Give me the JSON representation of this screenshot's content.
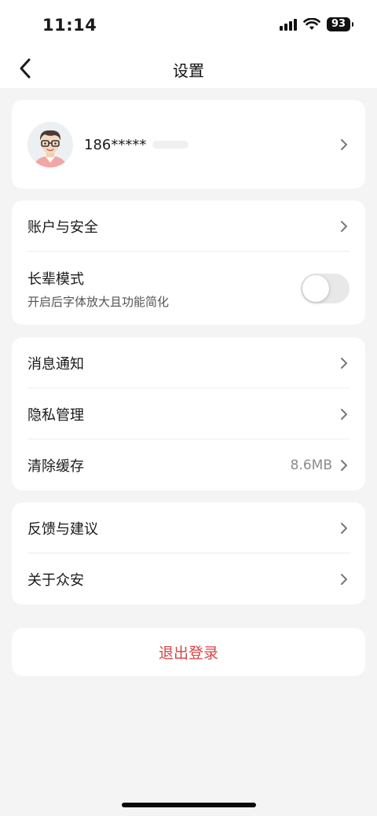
{
  "status_bar": {
    "time": "11:14",
    "battery": "93"
  },
  "nav": {
    "title": "设置"
  },
  "profile": {
    "phone": "186*****"
  },
  "account_section": {
    "account_security_label": "账户与安全",
    "elder_mode_label": "长辈模式",
    "elder_mode_desc": "开启后字体放大且功能简化",
    "elder_mode_enabled": false
  },
  "notice_section": {
    "notifications_label": "消息通知",
    "privacy_label": "隐私管理",
    "clear_cache_label": "清除缓存",
    "cache_size": "8.6MB"
  },
  "about_section": {
    "feedback_label": "反馈与建议",
    "about_label": "关于众安"
  },
  "logout": {
    "label": "退出登录"
  },
  "colors": {
    "accent_red": "#d64545",
    "background": "#f4f4f4"
  }
}
